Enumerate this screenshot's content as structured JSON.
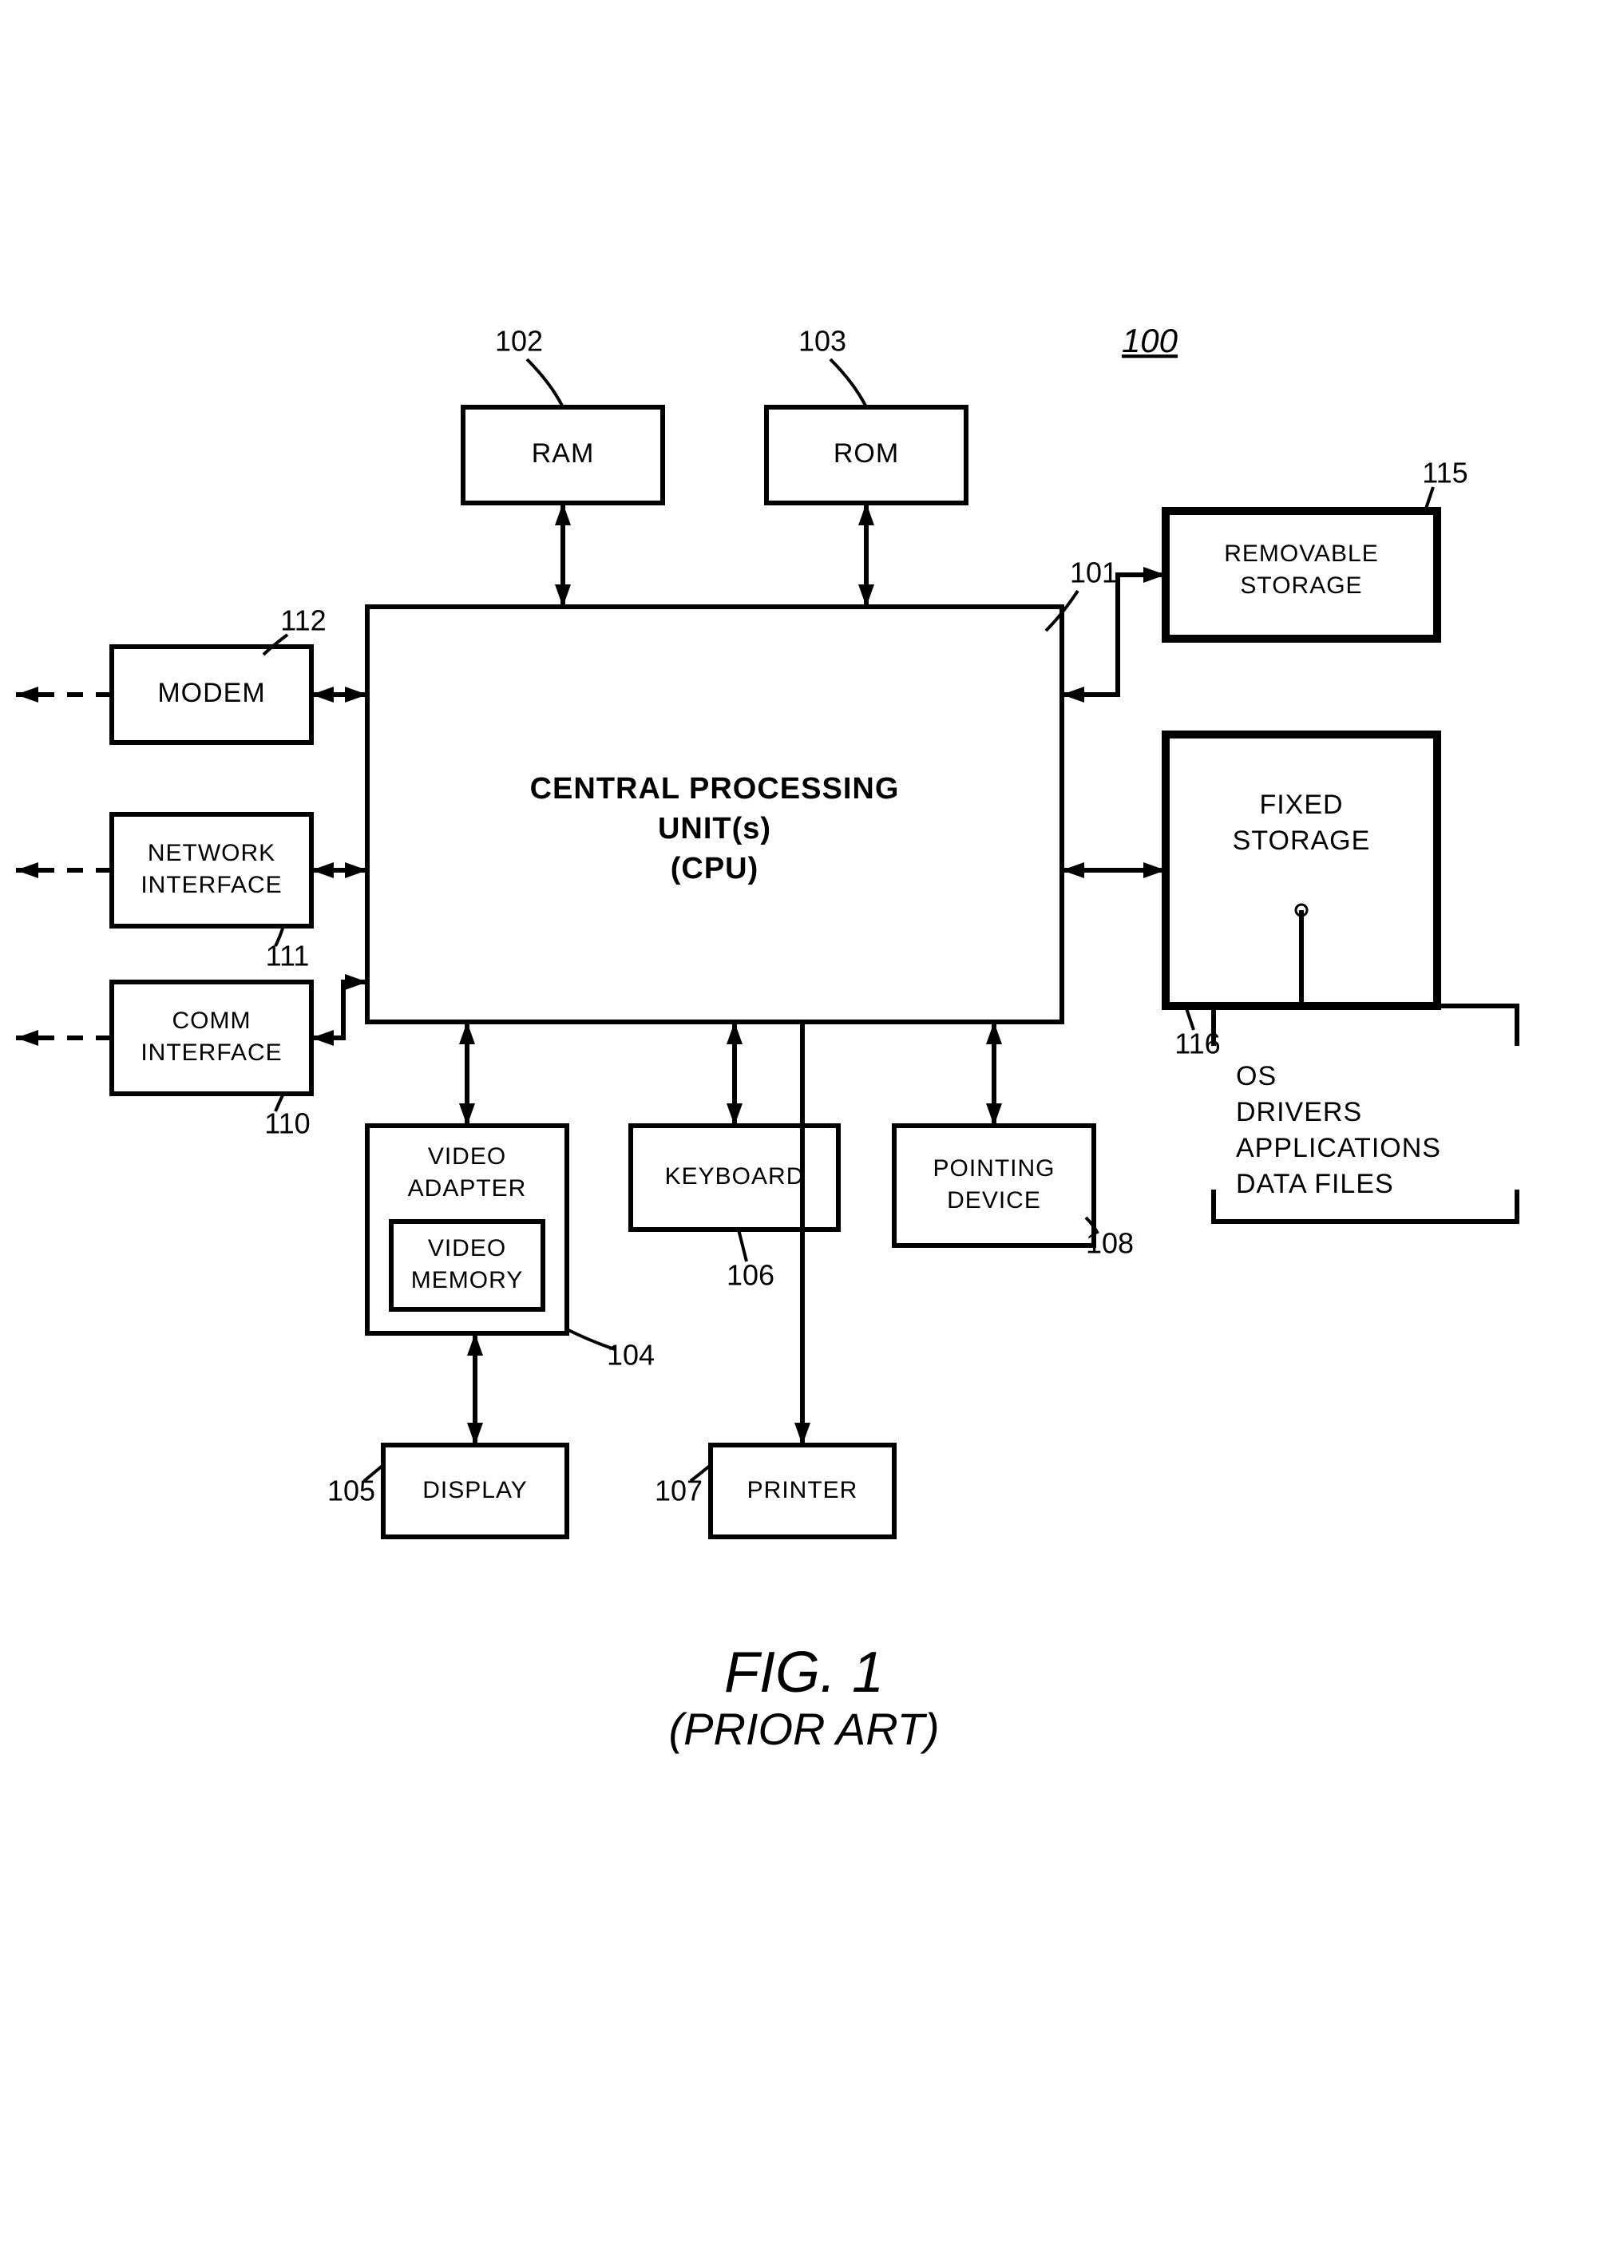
{
  "figure": {
    "number": "FIG. 1",
    "subtitle": "(PRIOR ART)",
    "system_ref": "100"
  },
  "cpu": {
    "line1": "CENTRAL PROCESSING",
    "line2": "UNIT(s)",
    "line3": "(CPU)",
    "ref": "101"
  },
  "blocks": {
    "ram": {
      "label": "RAM",
      "ref": "102"
    },
    "rom": {
      "label": "ROM",
      "ref": "103"
    },
    "modem": {
      "label": "MODEM",
      "ref": "112"
    },
    "net": {
      "line1": "NETWORK",
      "line2": "INTERFACE",
      "ref": "111"
    },
    "comm": {
      "line1": "COMM",
      "line2": "INTERFACE",
      "ref": "110"
    },
    "video": {
      "line1": "VIDEO",
      "line2": "ADAPTER",
      "mem1": "VIDEO",
      "mem2": "MEMORY",
      "ref": "104"
    },
    "display": {
      "label": "DISPLAY",
      "ref": "105"
    },
    "keyboard": {
      "label": "KEYBOARD",
      "ref": "106"
    },
    "printer": {
      "label": "PRINTER",
      "ref": "107"
    },
    "pointing": {
      "line1": "POINTING",
      "line2": "DEVICE",
      "ref": "108"
    },
    "removable": {
      "line1": "REMOVABLE",
      "line2": "STORAGE",
      "ref": "115"
    },
    "fixed": {
      "line1": "FIXED",
      "line2": "STORAGE",
      "ref": "116"
    }
  },
  "storage_contents": {
    "a": "OS",
    "b": "DRIVERS",
    "c": "APPLICATIONS",
    "d": "DATA FILES"
  }
}
